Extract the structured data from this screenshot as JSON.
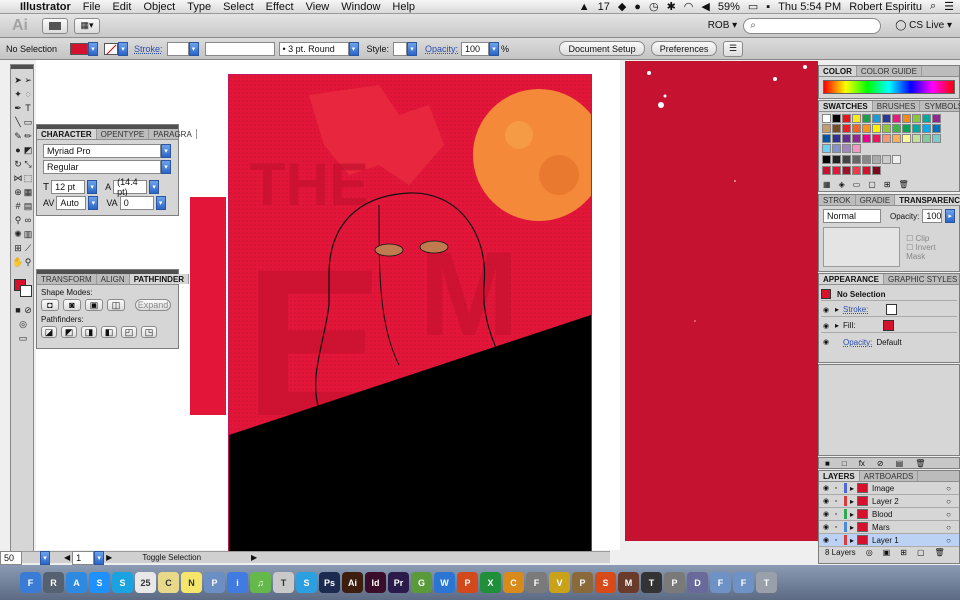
{
  "menubar": {
    "app": "Illustrator",
    "items": [
      "File",
      "Edit",
      "Object",
      "Type",
      "Select",
      "Effect",
      "View",
      "Window",
      "Help"
    ],
    "status_number": "17",
    "battery": "59%",
    "time": "Thu 5:54 PM",
    "user": "Robert Espiritu"
  },
  "appbar": {
    "logo": "Ai",
    "workspace": "ROB",
    "cs_live": "CS Live"
  },
  "controlbar": {
    "selection": "No Selection",
    "stroke_label": "Stroke:",
    "brush": "3 pt. Round",
    "style_label": "Style:",
    "opacity_label": "Opacity:",
    "opacity_value": "100",
    "percent": "%",
    "document_setup": "Document Setup",
    "preferences": "Preferences",
    "fill_color": "#d5122e"
  },
  "character_panel": {
    "tabs": [
      "CHARACTER",
      "OPENTYPE",
      "PARAGRA"
    ],
    "font": "Myriad Pro",
    "style": "Regular",
    "size": "12 pt",
    "leading": "(14.4 pt)",
    "tracking": "Auto",
    "kerning": "0"
  },
  "pathfinder_panel": {
    "tabs": [
      "TRANSFORM",
      "ALIGN",
      "PATHFINDER"
    ],
    "shape_modes": "Shape Modes:",
    "pathfinders": "Pathfinders:",
    "expand": "Expand"
  },
  "color_panel": {
    "tabs": [
      "COLOR",
      "COLOR GUIDE"
    ]
  },
  "swatches_panel": {
    "tabs": [
      "SWATCHES",
      "BRUSHES",
      "SYMBOLS"
    ],
    "colors": [
      "#ffffff",
      "#000000",
      "#e8141a",
      "#f7ec1a",
      "#1aa04a",
      "#1a9ad6",
      "#2a3a94",
      "#e8197f",
      "#f08a1d",
      "#8cc63f",
      "#00a99d",
      "#92278f",
      "#c69c6d",
      "#754c24",
      "#ed1c24",
      "#f26522",
      "#f7941d",
      "#fff200",
      "#8dc63f",
      "#39b54a",
      "#00a651",
      "#00a99d",
      "#00aeef",
      "#0072bc",
      "#0054a6",
      "#2e3192",
      "#662d91",
      "#92278f",
      "#ec008c",
      "#ed145b",
      "#f69679",
      "#fbaf5d",
      "#fff799",
      "#c4df9b",
      "#82ca9c",
      "#7accc8",
      "#6dcff6",
      "#8393ca",
      "#a186be",
      "#f49ac1"
    ],
    "grays": [
      "#000000",
      "#222222",
      "#444444",
      "#666666",
      "#888888",
      "#aaaaaa",
      "#cccccc",
      "#eeeeee"
    ],
    "reds": [
      "#c41230",
      "#e3163a",
      "#a10f28",
      "#f03a4a",
      "#d5122e",
      "#7a0a1e"
    ]
  },
  "transparency_panel": {
    "tabs": [
      "STROK",
      "GRADIE",
      "TRANSPARENCY"
    ],
    "mode": "Normal",
    "opacity_label": "Opacity:",
    "opacity": "100",
    "clip": "Clip",
    "invert_mask": "Invert Mask"
  },
  "appearance_panel": {
    "tabs": [
      "APPEARANCE",
      "GRAPHIC STYLES"
    ],
    "title": "No Selection",
    "stroke": "Stroke:",
    "fill": "Fill:",
    "opacity": "Opacity:",
    "opacity_value": "Default"
  },
  "layers_panel": {
    "tabs": [
      "LAYERS",
      "ARTBOARDS"
    ],
    "layers": [
      {
        "name": "Image",
        "color": "#4a6ad8"
      },
      {
        "name": "Layer 2",
        "color": "#d63c3c"
      },
      {
        "name": "Blood",
        "color": "#2fa84f"
      },
      {
        "name": "Mars",
        "color": "#4a8ad8"
      },
      {
        "name": "Layer 1",
        "color": "#d63c3c"
      }
    ],
    "count": "8 Layers"
  },
  "status": {
    "zoom": "50",
    "page": "1",
    "toggle": "Toggle Selection"
  },
  "dock": {
    "apps": [
      {
        "label": "F",
        "color": "#3a7bd5"
      },
      {
        "label": "R",
        "color": "#556070"
      },
      {
        "label": "A",
        "color": "#2d8ae0"
      },
      {
        "label": "S",
        "color": "#1e90ff"
      },
      {
        "label": "S",
        "color": "#1aa3e0"
      },
      {
        "label": "25",
        "color": "#e8e8e8"
      },
      {
        "label": "C",
        "color": "#e8d88a"
      },
      {
        "label": "N",
        "color": "#f5e56a"
      },
      {
        "label": "P",
        "color": "#6b8fc4"
      },
      {
        "label": "i",
        "color": "#3f7be0"
      },
      {
        "label": "♫",
        "color": "#64b94a"
      },
      {
        "label": "T",
        "color": "#c9c9c9"
      },
      {
        "label": "S",
        "color": "#2b9fe0"
      },
      {
        "label": "Ps",
        "color": "#1b2a4e"
      },
      {
        "label": "Ai",
        "color": "#3d1e0e"
      },
      {
        "label": "Id",
        "color": "#3a0d2a"
      },
      {
        "label": "Pr",
        "color": "#2a1b4a"
      },
      {
        "label": "G",
        "color": "#5a9a3a"
      },
      {
        "label": "W",
        "color": "#2a76d2"
      },
      {
        "label": "P",
        "color": "#d3491b"
      },
      {
        "label": "X",
        "color": "#1f8f3a"
      },
      {
        "label": "C",
        "color": "#d88a1a"
      },
      {
        "label": "F",
        "color": "#7a7a7a"
      },
      {
        "label": "V",
        "color": "#c9a21a"
      },
      {
        "label": "P",
        "color": "#8a6a3a"
      },
      {
        "label": "S",
        "color": "#d84a1a"
      },
      {
        "label": "M",
        "color": "#6a3a2a"
      },
      {
        "label": "T",
        "color": "#333333"
      },
      {
        "label": "P",
        "color": "#7a7a7a"
      },
      {
        "label": "D",
        "color": "#6a6a9a"
      },
      {
        "label": "F",
        "color": "#6f92c6"
      },
      {
        "label": "F",
        "color": "#6f92c6"
      },
      {
        "label": "T",
        "color": "#9aa0aa"
      }
    ]
  }
}
